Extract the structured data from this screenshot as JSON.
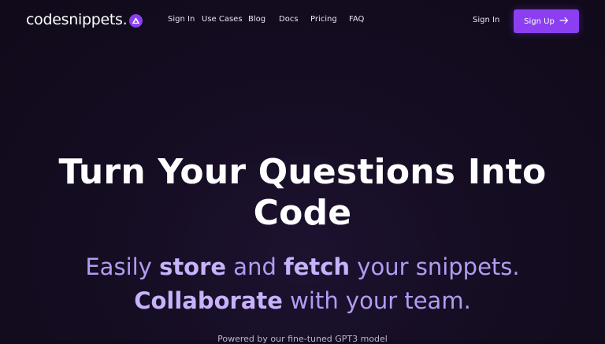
{
  "brand": {
    "name": "codesnippets",
    "dot": ".",
    "accent": "#8b3ff1"
  },
  "nav": {
    "links": [
      "Sign In",
      "Use Cases",
      "Blog",
      "Docs",
      "Pricing",
      "FAQ"
    ],
    "signin_label": "Sign In",
    "signup_label": "Sign Up"
  },
  "hero": {
    "title_line1": "Turn Your Questions Into",
    "title_line2": "Code",
    "sub1_a": "Easily ",
    "sub1_b": "store",
    "sub1_c": " and ",
    "sub1_d": "fetch",
    "sub1_e": " your snippets.",
    "sub2_a": "Collaborate",
    "sub2_b": " with your team.",
    "powered": "Powered by our fine-tuned GPT3 model"
  },
  "icons": {
    "logo_badge": "chevron-up-icon",
    "signup_arrow": "arrow-right-icon"
  }
}
